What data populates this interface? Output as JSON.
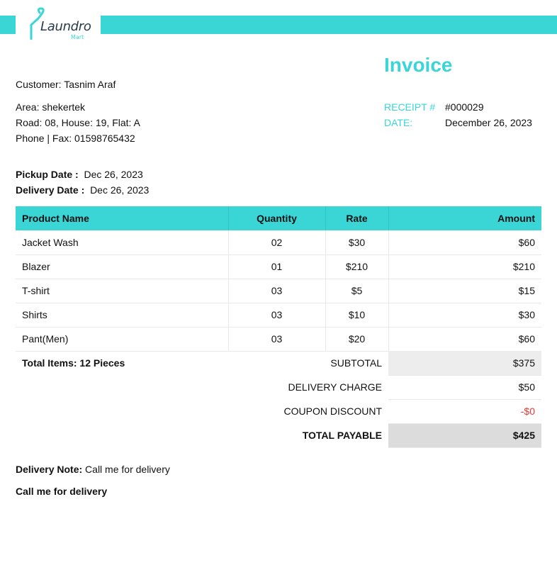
{
  "brand": {
    "name": "Laundro",
    "sub": "Mart",
    "accent_color": "#3ad6d6"
  },
  "invoice": {
    "title": "Invoice",
    "receipt_label": "RECEIPT #",
    "receipt_value": "#000029",
    "date_label": "DATE:",
    "date_value": "December 26, 2023"
  },
  "customer": {
    "name_line": "Customer: Tasnim Araf",
    "area_line": "Area: shekertek",
    "address_line": "Road: 08, House: 19, Flat: A",
    "phone_line": "Phone | Fax: 01598765432"
  },
  "dates": {
    "pickup_label": "Pickup Date :",
    "pickup_value": "Dec 26, 2023",
    "delivery_label": "Delivery Date :",
    "delivery_value": "Dec 26, 2023"
  },
  "table": {
    "headers": [
      "Product Name",
      "Quantity",
      "Rate",
      "Amount"
    ],
    "rows": [
      [
        "Jacket Wash",
        "02",
        "$30",
        "$60"
      ],
      [
        "Blazer",
        "01",
        "$210",
        "$210"
      ],
      [
        "T-shirt",
        "03",
        "$5",
        "$15"
      ],
      [
        "Shirts",
        "03",
        "$10",
        "$30"
      ],
      [
        "Pant(Men)",
        "03",
        "$20",
        "$60"
      ]
    ]
  },
  "totals": {
    "total_items": "Total Items: 12 Pieces",
    "subtotal_label": "SUBTOTAL",
    "subtotal_value": "$375",
    "delivery_label": "DELIVERY CHARGE",
    "delivery_value": "$50",
    "coupon_label": "COUPON DISCOUNT",
    "coupon_value": "-$0",
    "payable_label": "TOTAL PAYABLE",
    "payable_value": "$425"
  },
  "notes": {
    "delivery_note_label": "Delivery Note:",
    "delivery_note_value": "Call me for delivery",
    "note_repeat": "Call me for delivery"
  }
}
